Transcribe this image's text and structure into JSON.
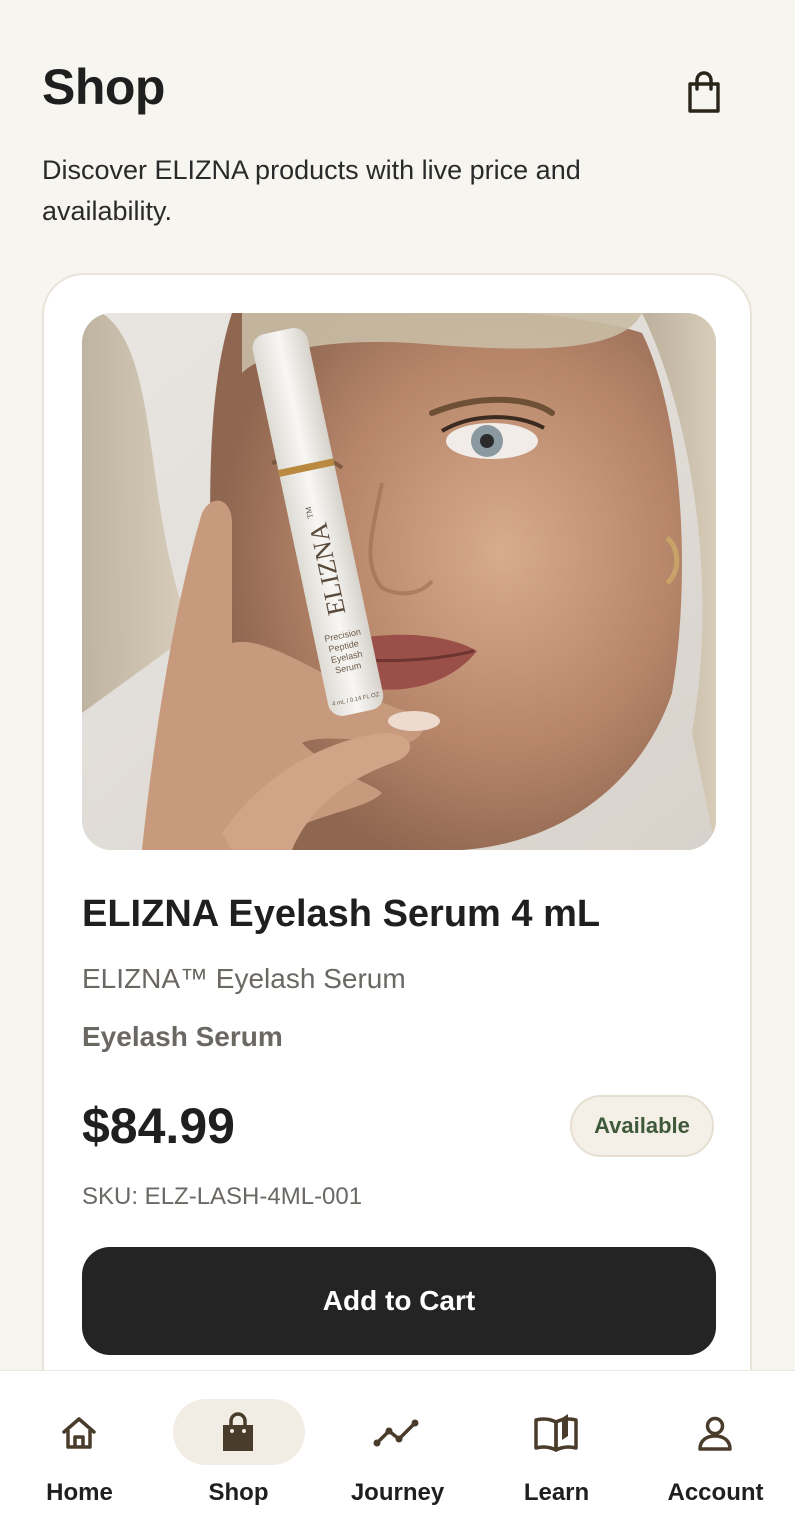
{
  "header": {
    "title": "Shop",
    "subtitle": "Discover ELIZNA products with live price and availability."
  },
  "product": {
    "title": "ELIZNA Eyelash Serum 4 mL",
    "subtitle": "ELIZNA™ Eyelash Serum",
    "category": "Eyelash Serum",
    "price": "$84.99",
    "status": "Available",
    "sku": "SKU: ELZ-LASH-4ML-001",
    "add_to_cart_label": "Add to Cart",
    "image": {
      "bottle_brand": "ELIZNA",
      "bottle_tm": "TM",
      "bottle_line1": "Precision",
      "bottle_line2": "Peptide",
      "bottle_line3": "Eyelash",
      "bottle_line4": "Serum",
      "bottle_volume": "4 mL / 0.14 FL OZ"
    }
  },
  "nav": {
    "items": [
      {
        "label": "Home",
        "icon": "home-icon"
      },
      {
        "label": "Shop",
        "icon": "shopping-bag-icon",
        "active": true
      },
      {
        "label": "Journey",
        "icon": "trend-line-icon"
      },
      {
        "label": "Learn",
        "icon": "open-book-icon"
      },
      {
        "label": "Account",
        "icon": "user-icon"
      }
    ]
  },
  "colors": {
    "background": "#f7f5f0",
    "accent_dark": "#242424",
    "status_green": "#3f5a3b",
    "nav_active_bg": "#f2ede4",
    "icon_brown": "#4a3c2a"
  }
}
